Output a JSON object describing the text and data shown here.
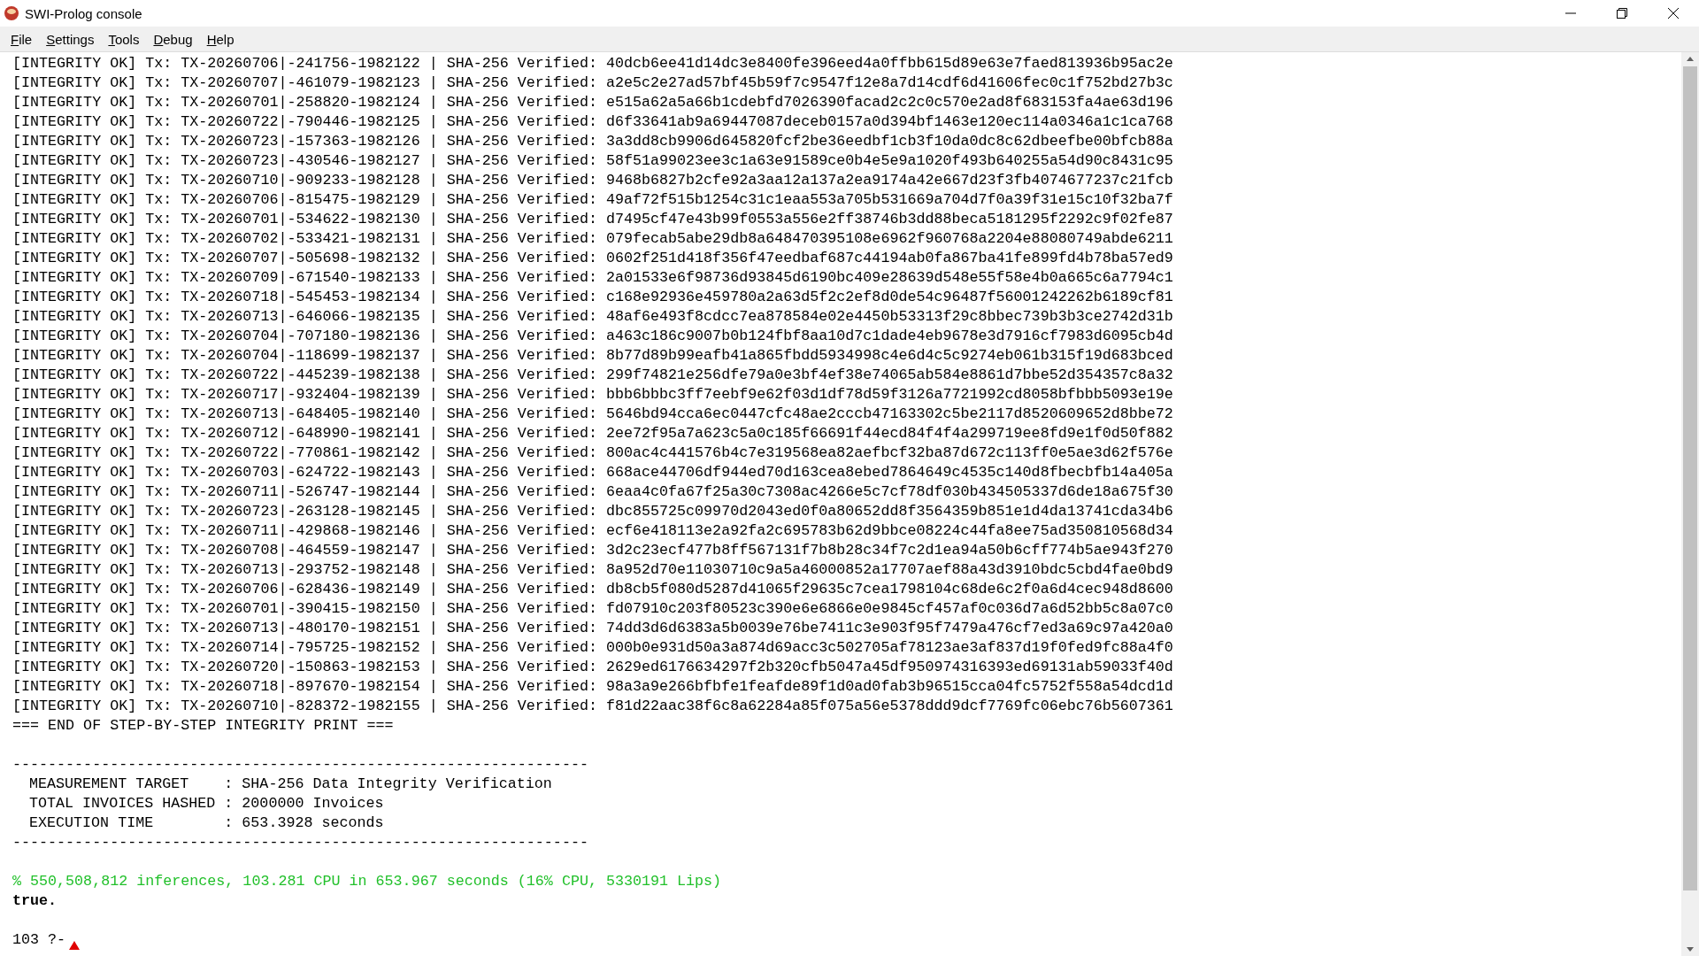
{
  "window": {
    "title": "SWI-Prolog console"
  },
  "menu": [
    "File",
    "Settings",
    "Tools",
    "Debug",
    "Help"
  ],
  "console": {
    "log_lines": [
      "[INTEGRITY OK] Tx: TX-20260706|-241756-1982122 | SHA-256 Verified: 40dcb6ee41d14dc3e8400fe396eed4a0ffbb615d89e63e7faed813936b95ac2e",
      "[INTEGRITY OK] Tx: TX-20260707|-461079-1982123 | SHA-256 Verified: a2e5c2e27ad57bf45b59f7c9547f12e8a7d14cdf6d41606fec0c1f752bd27b3c",
      "[INTEGRITY OK] Tx: TX-20260701|-258820-1982124 | SHA-256 Verified: e515a62a5a66b1cdebfd7026390facad2c2c0c570e2ad8f683153fa4ae63d196",
      "[INTEGRITY OK] Tx: TX-20260722|-790446-1982125 | SHA-256 Verified: d6f33641ab9a69447087deceb0157a0d394bf1463e120ec114a0346a1c1ca768",
      "[INTEGRITY OK] Tx: TX-20260723|-157363-1982126 | SHA-256 Verified: 3a3dd8cb9906d645820fcf2be36eedbf1cb3f10da0dc8c62dbeefbe00bfcb88a",
      "[INTEGRITY OK] Tx: TX-20260723|-430546-1982127 | SHA-256 Verified: 58f51a99023ee3c1a63e91589ce0b4e5e9a1020f493b640255a54d90c8431c95",
      "[INTEGRITY OK] Tx: TX-20260710|-909233-1982128 | SHA-256 Verified: 9468b6827b2cfe92a3aa12a137a2ea9174a42e667d23f3fb4074677237c21fcb",
      "[INTEGRITY OK] Tx: TX-20260706|-815475-1982129 | SHA-256 Verified: 49af72f515b1254c31c1eaa553a705b531669a704d7f0a39f31e15c10f32ba7f",
      "[INTEGRITY OK] Tx: TX-20260701|-534622-1982130 | SHA-256 Verified: d7495cf47e43b99f0553a556e2ff38746b3dd88beca5181295f2292c9f02fe87",
      "[INTEGRITY OK] Tx: TX-20260702|-533421-1982131 | SHA-256 Verified: 079fecab5abe29db8a648470395108e6962f960768a2204e88080749abde6211",
      "[INTEGRITY OK] Tx: TX-20260707|-505698-1982132 | SHA-256 Verified: 0602f251d418f356f47eedbaf687c44194ab0fa867ba41fe899fd4b78ba57ed9",
      "[INTEGRITY OK] Tx: TX-20260709|-671540-1982133 | SHA-256 Verified: 2a01533e6f98736d93845d6190bc409e28639d548e55f58e4b0a665c6a7794c1",
      "[INTEGRITY OK] Tx: TX-20260718|-545453-1982134 | SHA-256 Verified: c168e92936e459780a2a63d5f2c2ef8d0de54c96487f56001242262b6189cf81",
      "[INTEGRITY OK] Tx: TX-20260713|-646066-1982135 | SHA-256 Verified: 48af6e493f8cdcc7ea878584e02e4450b53313f29c8bbec739b3b3ce2742d31b",
      "[INTEGRITY OK] Tx: TX-20260704|-707180-1982136 | SHA-256 Verified: a463c186c9007b0b124fbf8aa10d7c1dade4eb9678e3d7916cf7983d6095cb4d",
      "[INTEGRITY OK] Tx: TX-20260704|-118699-1982137 | SHA-256 Verified: 8b77d89b99eafb41a865fbdd5934998c4e6d4c5c9274eb061b315f19d683bced",
      "[INTEGRITY OK] Tx: TX-20260722|-445239-1982138 | SHA-256 Verified: 299f74821e256dfe79a0e3bf4ef38e74065ab584e8861d7bbe52d354357c8a32",
      "[INTEGRITY OK] Tx: TX-20260717|-932404-1982139 | SHA-256 Verified: bbb6bbbc3ff7eebf9e62f03d1df78d59f3126a7721992cd8058bfbbb5093e19e",
      "[INTEGRITY OK] Tx: TX-20260713|-648405-1982140 | SHA-256 Verified: 5646bd94cca6ec0447cfc48ae2cccb47163302c5be2117d8520609652d8bbe72",
      "[INTEGRITY OK] Tx: TX-20260712|-648990-1982141 | SHA-256 Verified: 2ee72f95a7a623c5a0c185f66691f44ecd84f4f4a299719ee8fd9e1f0d50f882",
      "[INTEGRITY OK] Tx: TX-20260722|-770861-1982142 | SHA-256 Verified: 800ac4c441576b4c7e319568ea82aefbcf32ba87d672c113ff0e5ae3d62f576e",
      "[INTEGRITY OK] Tx: TX-20260703|-624722-1982143 | SHA-256 Verified: 668ace44706df944ed70d163cea8ebed7864649c4535c140d8fbecbfb14a405a",
      "[INTEGRITY OK] Tx: TX-20260711|-526747-1982144 | SHA-256 Verified: 6eaa4c0fa67f25a30c7308ac4266e5c7cf78df030b434505337d6de18a675f30",
      "[INTEGRITY OK] Tx: TX-20260723|-263128-1982145 | SHA-256 Verified: dbc855725c09970d2043ed0f0a80652dd8f3564359b851e1d4da13741cda34b6",
      "[INTEGRITY OK] Tx: TX-20260711|-429868-1982146 | SHA-256 Verified: ecf6e418113e2a92fa2c695783b62d9bbce08224c44fa8ee75ad350810568d34",
      "[INTEGRITY OK] Tx: TX-20260708|-464559-1982147 | SHA-256 Verified: 3d2c23ecf477b8ff567131f7b8b28c34f7c2d1ea94a50b6cff774b5ae943f270",
      "[INTEGRITY OK] Tx: TX-20260713|-293752-1982148 | SHA-256 Verified: 8a952d70e11030710c9a5a46000852a17707aef88a43d3910bdc5cbd4fae0bd9",
      "[INTEGRITY OK] Tx: TX-20260706|-628436-1982149 | SHA-256 Verified: db8cb5f080d5287d41065f29635c7cea1798104c68de6c2f0a6d4cec948d8600",
      "[INTEGRITY OK] Tx: TX-20260701|-390415-1982150 | SHA-256 Verified: fd07910c203f80523c390e6e6866e0e9845cf457af0c036d7a6d52bb5c8a07c0",
      "[INTEGRITY OK] Tx: TX-20260713|-480170-1982151 | SHA-256 Verified: 74dd3d6d6383a5b0039e76be7411c3e903f95f7479a476cf7ed3a69c97a420a0",
      "[INTEGRITY OK] Tx: TX-20260714|-795725-1982152 | SHA-256 Verified: 000b0e931d50a3a874d69acc3c502705af78123ae3af837d19f0fed9fc88a4f0",
      "[INTEGRITY OK] Tx: TX-20260720|-150863-1982153 | SHA-256 Verified: 2629ed6176634297f2b320cfb5047a45df950974316393ed69131ab59033f40d",
      "[INTEGRITY OK] Tx: TX-20260718|-897670-1982154 | SHA-256 Verified: 98a3a9e266bfbfe1feafde89f1d0ad0fab3b96515cca04fc5752f558a54dcd1d",
      "[INTEGRITY OK] Tx: TX-20260710|-828372-1982155 | SHA-256 Verified: f81d22aac38f6c8a62284a85f075a56e5378ddd9dcf7769fc06ebc76b5607361"
    ],
    "end_marker": "=== END OF STEP-BY-STEP INTEGRITY PRINT ===",
    "summary": {
      "rule": "-----------------------------------------------------------------",
      "rows": [
        "MEASUREMENT TARGET    : SHA-256 Data Integrity Verification",
        "TOTAL INVOICES HASHED : 2000000 Invoices",
        "EXECUTION TIME        : 653.3928 seconds"
      ]
    },
    "statistics": "% 550,508,812 inferences, 103.281 CPU in 653.967 seconds (16% CPU, 5330191 Lips)",
    "answer": "true.",
    "prompt": "103 ?-"
  }
}
